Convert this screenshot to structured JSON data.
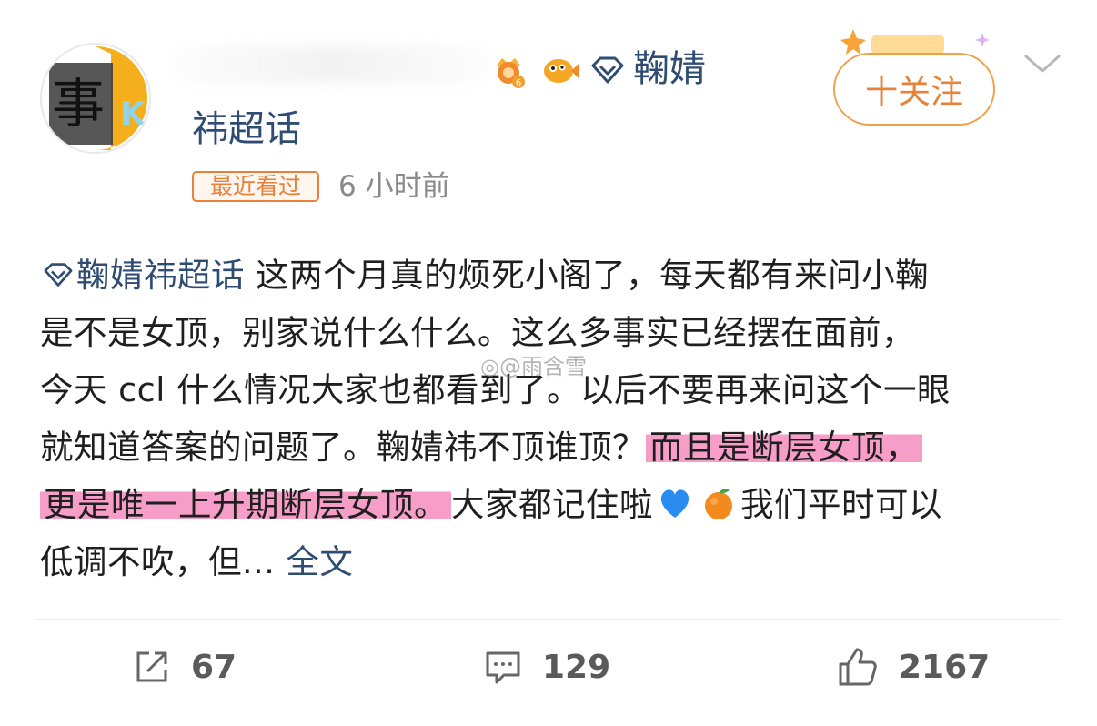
{
  "header": {
    "topic_name": "鞠婧",
    "group_name": "祎超话",
    "recent_tag": "最近看过",
    "time_ago": "6 小时前",
    "follow_label": "十关注",
    "avatar_text": "事"
  },
  "post": {
    "topic_tag": "鞠婧祎超话",
    "lines": [
      "这两个月真的烦死小阁了，每天都有来问小鞠",
      "是不是女顶，别家说什么什么。这么多事实已经摆在面前，",
      "今天 ccl 什么情况大家也都看到了。以后不要再来问这个一眼",
      "就知道答案的问题了。鞠婧祎不顶谁顶？",
      "而且是断层女顶，",
      "更是唯一上升期断层女顶。",
      "大家都记住啦",
      "我们平时可以",
      "低调不吹，但..."
    ],
    "more_link": "全文",
    "watermark": "@雨含雪"
  },
  "actions": {
    "share_count": "67",
    "comment_count": "129",
    "like_count": "2167"
  }
}
